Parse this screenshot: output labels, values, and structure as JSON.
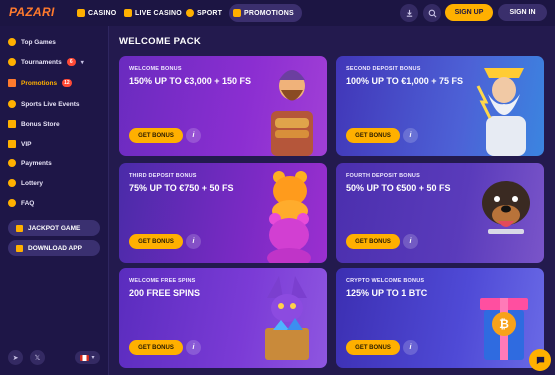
{
  "header": {
    "logo": "PAZARI",
    "nav": [
      {
        "label": "CASINO",
        "icon": "casino-icon"
      },
      {
        "label": "LIVE CASINO",
        "icon": "live-casino-icon"
      },
      {
        "label": "SPORT",
        "icon": "sport-icon"
      },
      {
        "label": "PROMOTIONS",
        "icon": "promotions-icon"
      }
    ],
    "signup": "SIGN UP",
    "signin": "SIGN IN"
  },
  "sidebar": {
    "items": [
      {
        "label": "Top Games",
        "icon": "fire-icon"
      },
      {
        "label": "Tournaments",
        "badge": "6",
        "icon": "trophy-icon"
      },
      {
        "label": "Promotions",
        "badge": "12",
        "icon": "gift-icon"
      },
      {
        "label": "Sports Live Events",
        "icon": "live-events-icon"
      },
      {
        "label": "Bonus Store",
        "icon": "store-icon"
      },
      {
        "label": "VIP",
        "icon": "crown-icon"
      },
      {
        "label": "Payments",
        "icon": "payments-icon"
      },
      {
        "label": "Lottery",
        "icon": "lottery-icon"
      },
      {
        "label": "FAQ",
        "icon": "faq-icon"
      }
    ],
    "jackpot": "JACKPOT GAME",
    "download": "DOWNLOAD APP"
  },
  "main": {
    "title": "WELCOME PACK",
    "cards": [
      {
        "sub": "WELCOME BONUS",
        "headline": "150% UP TO €3,000 + 150 FS",
        "cta": "GET BONUS"
      },
      {
        "sub": "SECOND DEPOSIT BONUS",
        "headline": "100% UP TO €1,000 + 75 FS",
        "cta": "GET BONUS"
      },
      {
        "sub": "THIRD DEPOSIT BONUS",
        "headline": "75% UP TO €750 + 50 FS",
        "cta": "GET BONUS"
      },
      {
        "sub": "FOURTH DEPOSIT BONUS",
        "headline": "50% UP TO €500 + 50 FS",
        "cta": "GET BONUS"
      },
      {
        "sub": "WELCOME FREE SPINS",
        "headline": "200 FREE SPINS",
        "cta": "GET BONUS"
      },
      {
        "sub": "CRYPTO WELCOME BONUS",
        "headline": "125% UP TO 1 BTC",
        "cta": "GET BONUS"
      }
    ]
  },
  "colors": {
    "accent": "#ffb000",
    "background": "#231a4e",
    "sidebar": "#1e1647",
    "badge": "#ff4a36"
  }
}
